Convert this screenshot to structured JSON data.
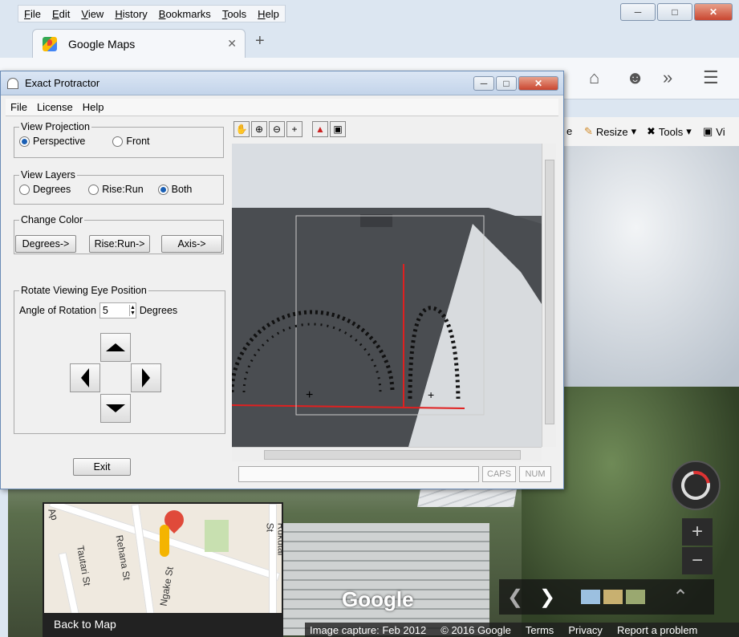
{
  "browser": {
    "menu": [
      "File",
      "Edit",
      "View",
      "History",
      "Bookmarks",
      "Tools",
      "Help"
    ],
    "tab_title": "Google Maps",
    "toolbar2": {
      "resize_label": "Resize",
      "tools_label": "Tools",
      "vi_label": "Vi",
      "partial_label": "e"
    }
  },
  "streetview": {
    "logo": "Google",
    "footer": [
      "Image capture: Feb 2012",
      "© 2016 Google",
      "Terms",
      "Privacy",
      "Report a problem"
    ],
    "back_to_map": "Back to Map",
    "street_labels": [
      "Tautari St",
      "Rehana St",
      "Ngake St",
      "Rukutai St",
      "Ap"
    ]
  },
  "protractor": {
    "title": "Exact Protractor",
    "menu": [
      "File",
      "License",
      "Help"
    ],
    "view_projection": {
      "legend": "View Projection",
      "options": [
        "Perspective",
        "Front"
      ],
      "selected": "Perspective"
    },
    "view_layers": {
      "legend": "View Layers",
      "options": [
        "Degrees",
        "Rise:Run",
        "Both"
      ],
      "selected": "Both"
    },
    "change_color": {
      "legend": "Change Color",
      "buttons": [
        "Degrees->",
        "Rise:Run->",
        "Axis->"
      ]
    },
    "rotate": {
      "legend": "Rotate Viewing Eye Position",
      "angle_label": "Angle of Rotation",
      "angle_value": "5",
      "unit": "Degrees"
    },
    "exit_label": "Exit",
    "status": {
      "caps": "CAPS",
      "num": "NUM"
    }
  },
  "colors": {
    "axis_red": "#e02020",
    "selected_radio": "#1a5fb4",
    "close_button": "#c94630"
  }
}
